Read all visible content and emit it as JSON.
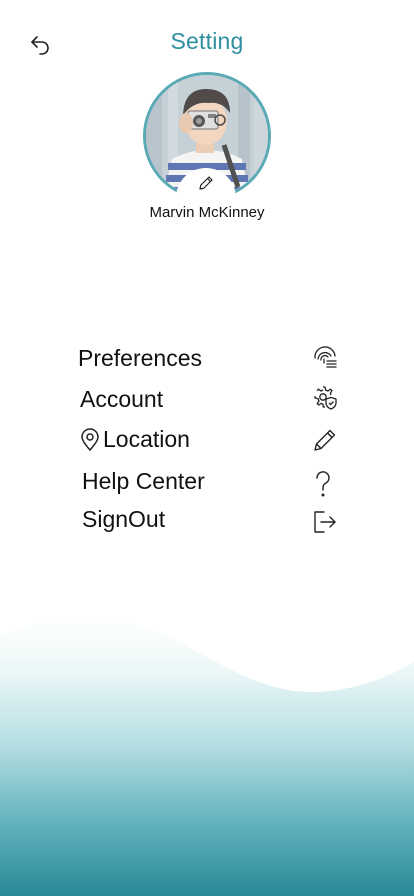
{
  "header": {
    "title": "Setting",
    "back_icon": "undo-arrow-icon"
  },
  "profile": {
    "name": "Marvin McKinney",
    "edit_icon": "pencil-icon"
  },
  "menu": {
    "items": [
      {
        "label": "Preferences",
        "icon": "fingerprint-list-icon"
      },
      {
        "label": "Account",
        "icon": "gear-shield-icon"
      },
      {
        "label": "Location",
        "icon": "pencil-icon",
        "leading_icon": "location-pin-icon"
      },
      {
        "label": "Help Center",
        "icon": "question-mark-icon"
      },
      {
        "label": "SignOut",
        "icon": "sign-out-icon"
      }
    ]
  },
  "colors": {
    "accent": "#2e8fa0",
    "avatar_border": "#5aaab5",
    "wave_top": "#e6f4f5",
    "wave_bottom": "#2a8897"
  }
}
